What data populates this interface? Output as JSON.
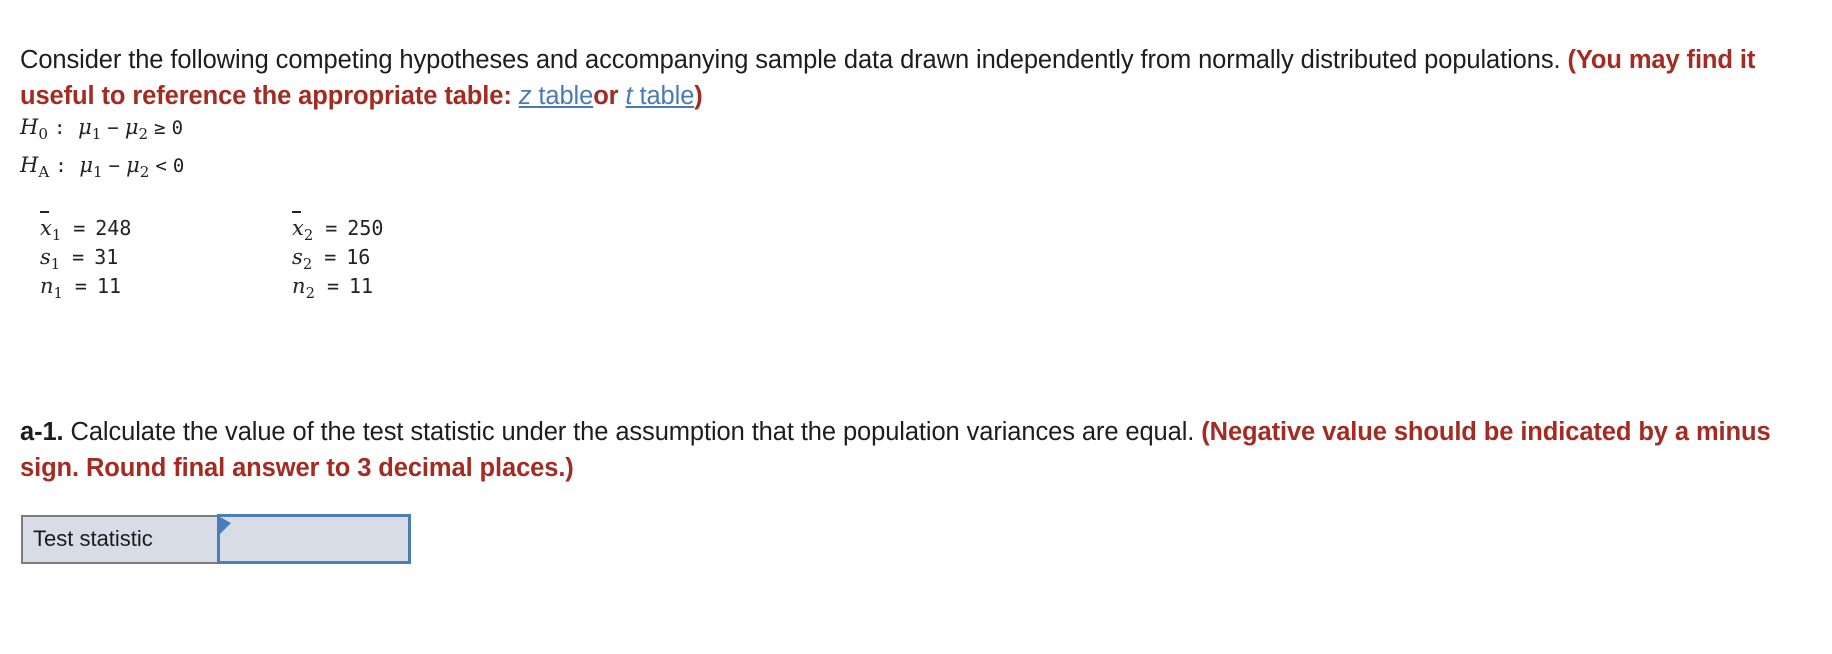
{
  "intro": {
    "sentence_part1": "Consider the following competing hypotheses and accompanying sample data drawn independently from normally distributed populations.",
    "hint_open": "(You may find it useful to reference the appropriate table:",
    "z_link_var": "z",
    "z_link_word": " table",
    "conjunction": "or",
    "t_link_var": "t",
    "t_link_word": " table",
    "hint_close": ")",
    "hint_color": "#a32b22",
    "link_color": "#4a79b8"
  },
  "hypotheses": [
    {
      "name": "H",
      "subscript": "0",
      "colon": ":",
      "term1": "μ",
      "term1_sub": "1",
      "operator1": "−",
      "term2": "μ",
      "term2_sub": "2",
      "relation": "≥",
      "value": "0"
    },
    {
      "name": "H",
      "subscript": "A",
      "colon": ":",
      "term1": "μ",
      "term1_sub": "1",
      "operator1": "−",
      "term2": "μ",
      "term2_sub": "2",
      "relation": "<",
      "value": "0"
    }
  ],
  "sample_stats": {
    "rows": [
      {
        "left": {
          "symbol": "x",
          "overbar": true,
          "sub": "1",
          "eq": "=",
          "value": "248"
        },
        "right": {
          "symbol": "x",
          "overbar": true,
          "sub": "2",
          "eq": "=",
          "value": "250"
        }
      },
      {
        "left": {
          "symbol": "s",
          "overbar": false,
          "sub": "1",
          "eq": "=",
          "value": "31"
        },
        "right": {
          "symbol": "s",
          "overbar": false,
          "sub": "2",
          "eq": "=",
          "value": "16"
        }
      },
      {
        "left": {
          "symbol": "n",
          "overbar": false,
          "sub": "1",
          "eq": "=",
          "value": "11"
        },
        "right": {
          "symbol": "n",
          "overbar": false,
          "sub": "2",
          "eq": "=",
          "value": "11"
        }
      }
    ]
  },
  "question": {
    "label": "a-1.",
    "text": " Calculate the value of the test statistic under the assumption that the population variances are equal. ",
    "instruction": "(Negative value should be indicated by a minus sign. Round final answer to 3 decimal places.)",
    "instruction_color": "#a32b22"
  },
  "answer": {
    "row_label": "Test statistic",
    "input_value": "",
    "input_placeholder": "",
    "input_border_color": "#4a7ebb",
    "cell_background": "#d7dce6",
    "label_border_color": "#7c7c7c"
  }
}
